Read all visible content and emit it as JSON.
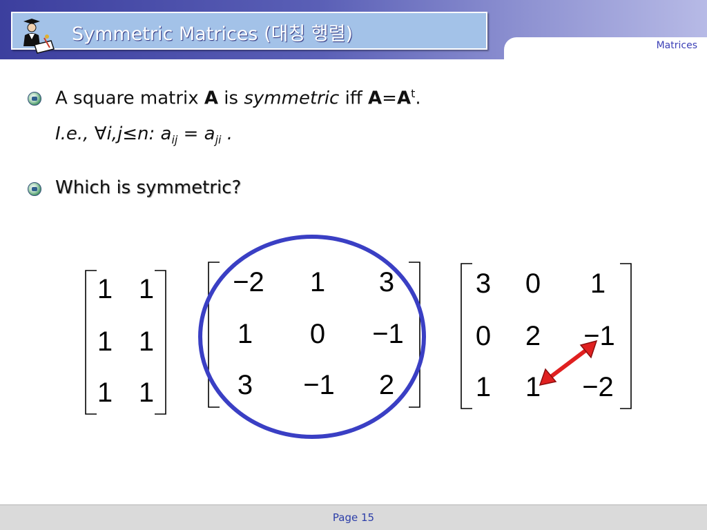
{
  "slide": {
    "title": "Symmetric Matrices (대칭 행렬)",
    "section_label": "Matrices",
    "page_label": "Page 15"
  },
  "content": {
    "bullet1": {
      "prefix": "A square matrix ",
      "bold_a": "A",
      "mid": " is ",
      "italic_word": "symmetric",
      "iff": " iff ",
      "eq_a": "A",
      "eq_sign": "=",
      "eq_b": "A",
      "sup_t": "t",
      "end": "."
    },
    "line2": {
      "ie": "I.e.",
      "comma": ", ",
      "forall": "∀i,j≤n: a",
      "sub_ij": "ij",
      "equals": " = a",
      "sub_ji": "ji",
      "end": " ."
    },
    "bullet2": "Which is symmetric?"
  },
  "matrices": [
    {
      "rows": [
        [
          "1",
          "1"
        ],
        [
          "1",
          "1"
        ],
        [
          "1",
          "1"
        ]
      ]
    },
    {
      "rows": [
        [
          "−2",
          "1",
          "3"
        ],
        [
          "1",
          "0",
          "−1"
        ],
        [
          "3",
          "−1",
          "2"
        ]
      ],
      "highlight": "circled",
      "highlight_color": "#3a3fc4"
    },
    {
      "rows": [
        [
          "3",
          "0",
          "1"
        ],
        [
          "0",
          "2",
          "−1"
        ],
        [
          "1",
          "1",
          "−2"
        ]
      ],
      "annotation": "arrow between −1 and 1",
      "arrow_color": "#e02020"
    }
  ]
}
